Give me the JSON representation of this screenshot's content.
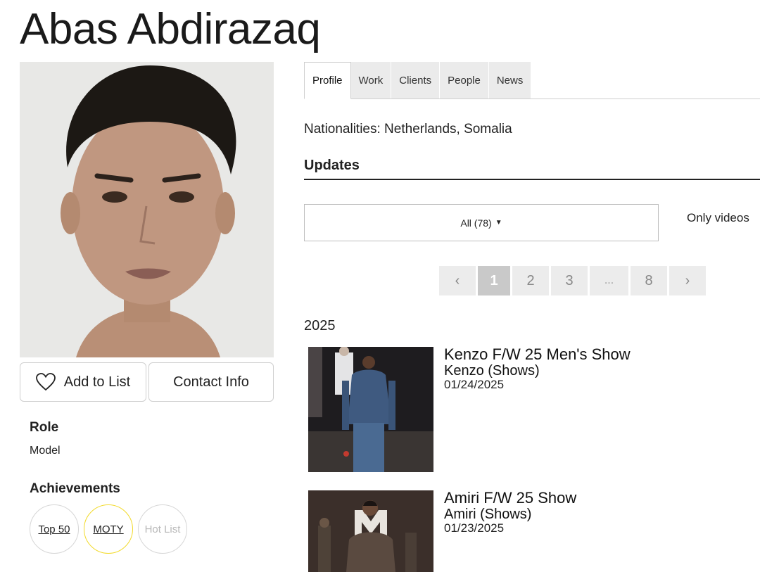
{
  "profile": {
    "name": "Abas Abdirazaq"
  },
  "actions": {
    "add_to_list": "Add to List",
    "contact_info": "Contact Info"
  },
  "role": {
    "title": "Role",
    "value": "Model"
  },
  "achievements": {
    "title": "Achievements",
    "items": [
      "Top 50",
      "MOTY",
      "Hot List"
    ],
    "colors": {
      "moty_ring": "#f2da2a",
      "inactive_text": "#b8b8b8"
    }
  },
  "tabs": [
    "Profile",
    "Work",
    "Clients",
    "People",
    "News"
  ],
  "active_tab": "Profile",
  "nationalities": "Nationalities: Netherlands, Somalia",
  "updates": {
    "title": "Updates",
    "filter": "All (78)",
    "only_videos": "Only videos"
  },
  "pagination": {
    "prev": "‹",
    "pages": [
      "1",
      "2",
      "3",
      "...",
      "8"
    ],
    "next": "›",
    "current": "1"
  },
  "year": "2025",
  "feed": [
    {
      "title": "Kenzo F/W 25 Men's Show",
      "subtitle": "Kenzo (Shows)",
      "date": "01/24/2025"
    },
    {
      "title": "Amiri F/W 25 Show",
      "subtitle": "Amiri (Shows)",
      "date": "01/23/2025"
    }
  ]
}
